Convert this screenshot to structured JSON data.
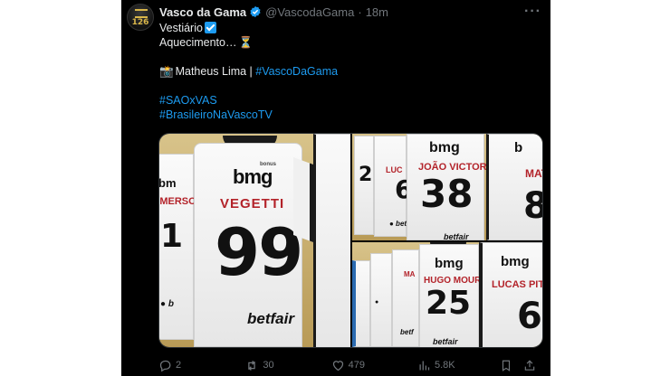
{
  "tweet": {
    "author_name": "Vasco da Gama",
    "handle": "@VascodaGama",
    "separator": "·",
    "time": "18m",
    "avatar_text": "126",
    "lines": {
      "line1": "Vestiário",
      "line2": "Aquecimento…",
      "photo_credit": "Matheus Lima | ",
      "photo_credit_tag": "#VascoDaGama",
      "hashtag1": "#SAOxVAS",
      "hashtag2": "#BrasileiroNaVascoTV"
    },
    "colors": {
      "link": "#1d9bf0",
      "verified": "#1d9bf0",
      "background": "#000000"
    }
  },
  "media": {
    "main": {
      "brand": "bmg",
      "brand_small": "bonus",
      "player": "VEGETTI",
      "number": "99",
      "sponsor": "betfair",
      "left_name": "EMERSO",
      "left_num": "1",
      "left_brand": "bm"
    },
    "top_right": {
      "player1": "JOÃO VICTOR",
      "number1": "38",
      "player2": "LUC",
      "number2": "6",
      "player3": "MATH",
      "number3": "8",
      "left_num": "2",
      "brand": "bmg",
      "sponsor": "betfair"
    },
    "bottom_right": {
      "player1": "HUGO MOURA",
      "number1": "25",
      "player2": "LUCAS PIT",
      "number2": "6",
      "brand": "bmg",
      "sponsor": "betfair"
    }
  },
  "actions": {
    "replies": "2",
    "reposts": "30",
    "likes": "479",
    "views": "5.8K"
  }
}
